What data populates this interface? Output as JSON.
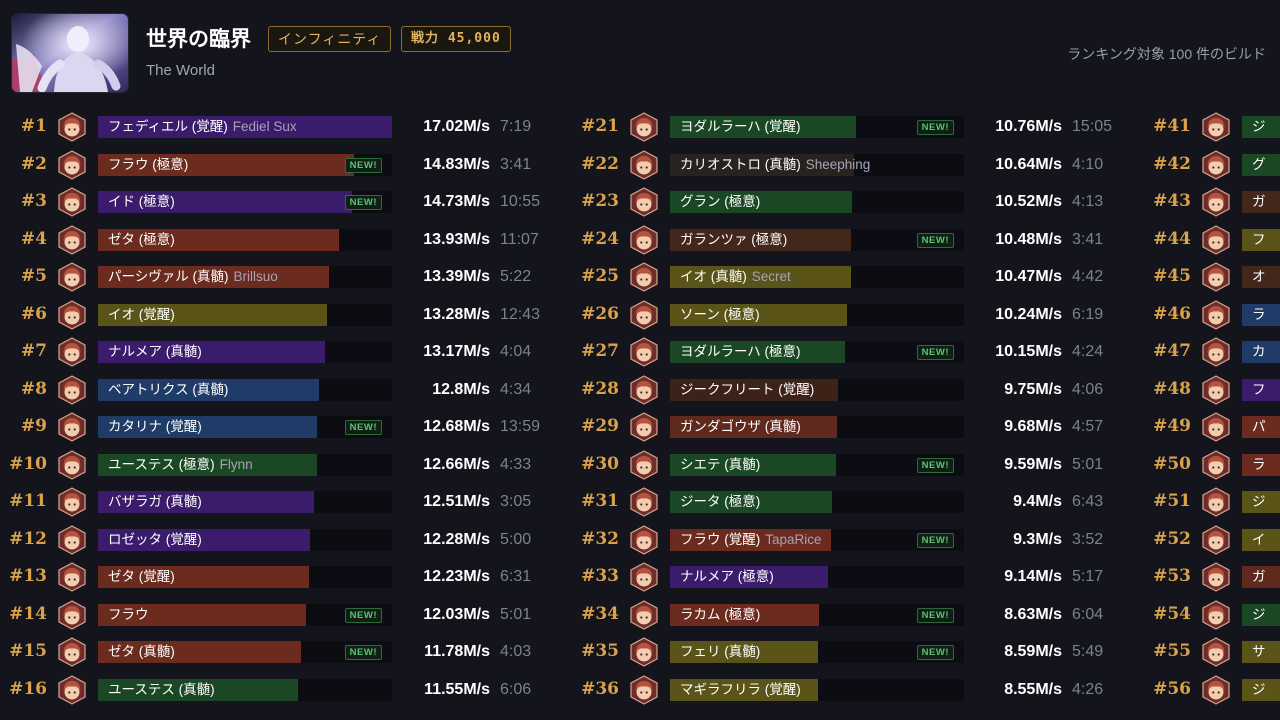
{
  "header": {
    "boss_title": "世界の臨界",
    "boss_subtitle": "The World",
    "difficulty_badge": "インフィニティ",
    "power_badge": "戦力 45,000",
    "ranking_count": "ランキング対象 100 件のビルド",
    "avatar_icon": "boss-portrait"
  },
  "labels": {
    "new_badge": "NEW!"
  },
  "icons": {
    "row_portrait": "character-portrait-icon"
  },
  "colors": {
    "background": "#13141c",
    "rank": "#d9a24b",
    "badge_text": "#e2b35d",
    "badge_border": "#8e6b2c",
    "new_text": "#5cc174",
    "track": "#0c0d13"
  },
  "ranking": {
    "columns": [
      {
        "rows": [
          {
            "rank": "#1",
            "character": "フェディエル (覚醒)",
            "player": "Fediel Sux",
            "dps": "17.02M/s",
            "time": "7:19",
            "color": "#3b1c6c"
          },
          {
            "rank": "#2",
            "character": "フラウ (極意)",
            "dps": "14.83M/s",
            "time": "3:41",
            "new": true,
            "color": "#6b2b1e"
          },
          {
            "rank": "#3",
            "character": "イド (極意)",
            "dps": "14.73M/s",
            "time": "10:55",
            "new": true,
            "color": "#3b1c6c"
          },
          {
            "rank": "#4",
            "character": "ゼタ (極意)",
            "dps": "13.93M/s",
            "time": "11:07",
            "color": "#6b2b1e"
          },
          {
            "rank": "#5",
            "character": "パーシヴァル (真髄)",
            "player": "Brillsuo",
            "dps": "13.39M/s",
            "time": "5:22",
            "color": "#6b2b1e"
          },
          {
            "rank": "#6",
            "character": "イオ (覚醒)",
            "dps": "13.28M/s",
            "time": "12:43",
            "color": "#5a5419"
          },
          {
            "rank": "#7",
            "character": "ナルメア (真髄)",
            "dps": "13.17M/s",
            "time": "4:04",
            "color": "#3b1c6c"
          },
          {
            "rank": "#8",
            "character": "ベアトリクス (真髄)",
            "dps": "12.8M/s",
            "time": "4:34",
            "color": "#1f3c69"
          },
          {
            "rank": "#9",
            "character": "カタリナ (覚醒)",
            "dps": "12.68M/s",
            "time": "13:59",
            "new": true,
            "color": "#1f3c69"
          },
          {
            "rank": "#10",
            "character": "ユーステス (極意)",
            "player": "Flynn",
            "dps": "12.66M/s",
            "time": "4:33",
            "color": "#1b4824"
          },
          {
            "rank": "#11",
            "character": "バザラガ (真髄)",
            "dps": "12.51M/s",
            "time": "3:05",
            "color": "#3b1c6c"
          },
          {
            "rank": "#12",
            "character": "ロゼッタ (覚醒)",
            "dps": "12.28M/s",
            "time": "5:00",
            "color": "#3b1c6c"
          },
          {
            "rank": "#13",
            "character": "ゼタ (覚醒)",
            "dps": "12.23M/s",
            "time": "6:31",
            "color": "#6b2b1e"
          },
          {
            "rank": "#14",
            "character": "フラウ",
            "dps": "12.03M/s",
            "time": "5:01",
            "new": true,
            "color": "#6b2b1e"
          },
          {
            "rank": "#15",
            "character": "ゼタ (真髄)",
            "dps": "11.78M/s",
            "time": "4:03",
            "new": true,
            "color": "#6b2b1e"
          },
          {
            "rank": "#16",
            "character": "ユーステス (真髄)",
            "dps": "11.55M/s",
            "time": "6:06",
            "color": "#1b4824"
          }
        ]
      },
      {
        "rows": [
          {
            "rank": "#21",
            "character": "ヨダルラーハ (覚醒)",
            "dps": "10.76M/s",
            "time": "15:05",
            "new": true,
            "color": "#1b4824"
          },
          {
            "rank": "#22",
            "character": "カリオストロ (真髄)",
            "player": "Sheephing",
            "dps": "10.64M/s",
            "time": "4:10",
            "color": "#29231f"
          },
          {
            "rank": "#23",
            "character": "グラン (極意)",
            "dps": "10.52M/s",
            "time": "4:13",
            "color": "#1b4824"
          },
          {
            "rank": "#24",
            "character": "ガランツァ (極意)",
            "dps": "10.48M/s",
            "time": "3:41",
            "new": true,
            "color": "#43271b"
          },
          {
            "rank": "#25",
            "character": "イオ (真髄)",
            "player": "Secret",
            "dps": "10.47M/s",
            "time": "4:42",
            "color": "#5a5419"
          },
          {
            "rank": "#26",
            "character": "ソーン (極意)",
            "dps": "10.24M/s",
            "time": "6:19",
            "color": "#5a5419"
          },
          {
            "rank": "#27",
            "character": "ヨダルラーハ (極意)",
            "dps": "10.15M/s",
            "time": "4:24",
            "new": true,
            "color": "#1b4824"
          },
          {
            "rank": "#28",
            "character": "ジークフリート (覚醒)",
            "dps": "9.75M/s",
            "time": "4:06",
            "color": "#3d2317"
          },
          {
            "rank": "#29",
            "character": "ガンダゴウザ (真髄)",
            "dps": "9.68M/s",
            "time": "4:57",
            "color": "#5f2a1d"
          },
          {
            "rank": "#30",
            "character": "シエテ (真髄)",
            "dps": "9.59M/s",
            "time": "5:01",
            "new": true,
            "color": "#1b4824"
          },
          {
            "rank": "#31",
            "character": "ジータ (極意)",
            "dps": "9.4M/s",
            "time": "6:43",
            "color": "#1b4824"
          },
          {
            "rank": "#32",
            "character": "フラウ (覚醒)",
            "player": "TapaRice",
            "dps": "9.3M/s",
            "time": "3:52",
            "new": true,
            "color": "#6b2b1e"
          },
          {
            "rank": "#33",
            "character": "ナルメア (極意)",
            "dps": "9.14M/s",
            "time": "5:17",
            "color": "#3b1c6c"
          },
          {
            "rank": "#34",
            "character": "ラカム (極意)",
            "dps": "8.63M/s",
            "time": "6:04",
            "new": true,
            "color": "#6b2b1e"
          },
          {
            "rank": "#35",
            "character": "フェリ (真髄)",
            "dps": "8.59M/s",
            "time": "5:49",
            "new": true,
            "color": "#5a5419"
          },
          {
            "rank": "#36",
            "character": "マギラフリラ (覚醒)",
            "dps": "8.55M/s",
            "time": "4:26",
            "color": "#5a5419"
          }
        ]
      },
      {
        "rows": [
          {
            "rank": "#41",
            "character": "ジ",
            "color": "#1b4824"
          },
          {
            "rank": "#42",
            "character": "グ",
            "color": "#1b4824"
          },
          {
            "rank": "#43",
            "character": "ガ",
            "color": "#43271b"
          },
          {
            "rank": "#44",
            "character": "フ",
            "color": "#5a5419"
          },
          {
            "rank": "#45",
            "character": "オ",
            "color": "#43271b"
          },
          {
            "rank": "#46",
            "character": "ラ",
            "color": "#1f3c69"
          },
          {
            "rank": "#47",
            "character": "カ",
            "color": "#1f3c69"
          },
          {
            "rank": "#48",
            "character": "フ",
            "color": "#3b1c6c"
          },
          {
            "rank": "#49",
            "character": "パ",
            "color": "#6b2b1e"
          },
          {
            "rank": "#50",
            "character": "ラ",
            "color": "#6b2b1e"
          },
          {
            "rank": "#51",
            "character": "ジ",
            "color": "#5a5419"
          },
          {
            "rank": "#52",
            "character": "イ",
            "color": "#5a5419"
          },
          {
            "rank": "#53",
            "character": "ガ",
            "color": "#5f2a1d"
          },
          {
            "rank": "#54",
            "character": "ジ",
            "color": "#1b4824"
          },
          {
            "rank": "#55",
            "character": "サ",
            "color": "#5a5419"
          },
          {
            "rank": "#56",
            "character": "ジ",
            "color": "#5a5419"
          }
        ]
      }
    ]
  }
}
